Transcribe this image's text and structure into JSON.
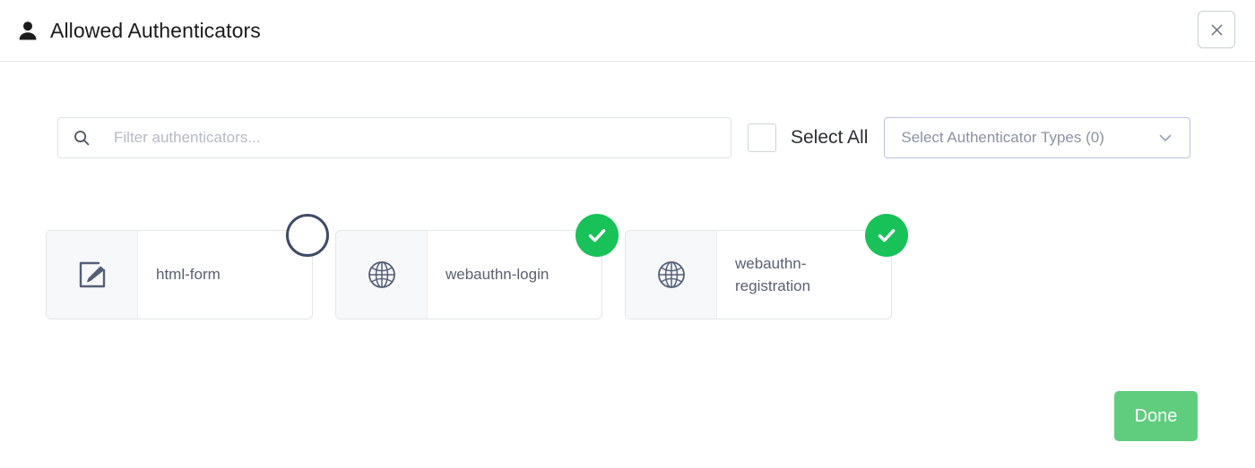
{
  "header": {
    "icon": "user-icon",
    "title": "Allowed Authenticators",
    "close_icon": "close-icon",
    "close_label": "Close"
  },
  "toolbar": {
    "search": {
      "icon": "search-icon",
      "placeholder": "Filter authenticators...",
      "value": ""
    },
    "select_all": {
      "label": "Select All",
      "checked": false
    },
    "types_dropdown": {
      "label": "Select Authenticator Types (0)",
      "count": 0,
      "icon": "chevron-down-icon",
      "expanded": false
    }
  },
  "cards": [
    {
      "name": "html-form",
      "icon": "edit-square-icon",
      "selected": false,
      "badge_icon": "empty-circle-icon"
    },
    {
      "name": "webauthn-login",
      "icon": "globe-icon",
      "selected": true,
      "badge_icon": "check-circle-icon"
    },
    {
      "name": "webauthn-registration",
      "icon": "globe-icon",
      "selected": true,
      "badge_icon": "check-circle-icon"
    }
  ],
  "footer": {
    "done_label": "Done"
  },
  "colors": {
    "accent_green": "#19c159",
    "button_green": "#5fcd7d",
    "icon_slate": "#545f77",
    "text_dark": "#1b1b1b",
    "text_muted": "#8b92a1",
    "border_light": "#e3e6ea",
    "dropdown_border": "#b9c3e0"
  }
}
